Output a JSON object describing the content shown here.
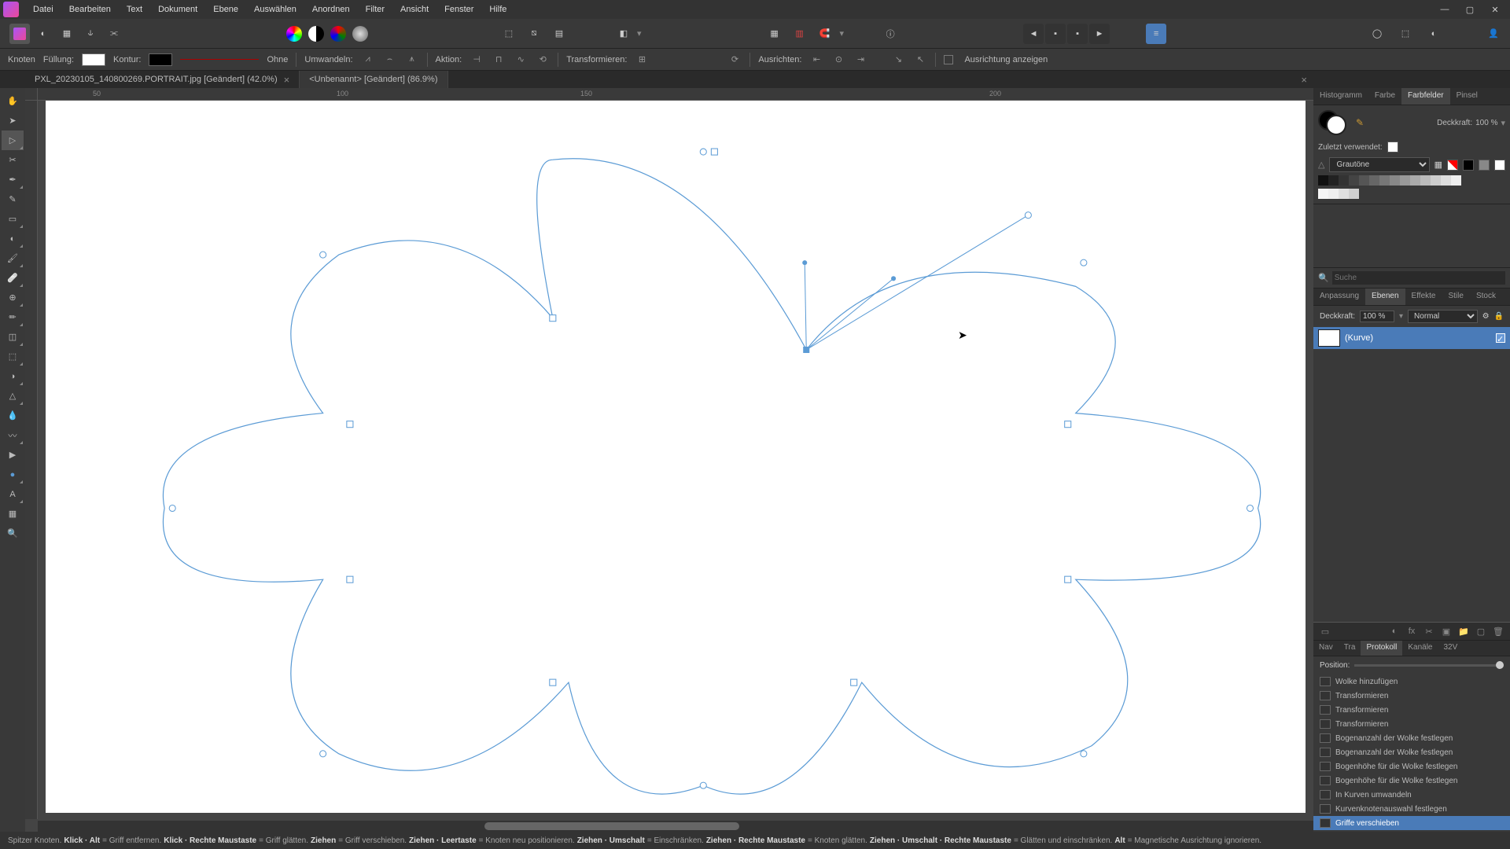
{
  "menu": {
    "items": [
      "Datei",
      "Bearbeiten",
      "Text",
      "Dokument",
      "Ebene",
      "Auswählen",
      "Anordnen",
      "Filter",
      "Ansicht",
      "Fenster",
      "Hilfe"
    ]
  },
  "ctx": {
    "knoten": "Knoten",
    "fuellung": "Füllung:",
    "kontur": "Kontur:",
    "ohne": "Ohne",
    "umwandeln": "Umwandeln:",
    "aktion": "Aktion:",
    "transformieren": "Transformieren:",
    "ausrichten": "Ausrichten:",
    "ausrichtung": "Ausrichtung anzeigen"
  },
  "tabs": {
    "t1": "PXL_20230105_140800269.PORTRAIT.jpg [Geändert] (42.0%)",
    "t2": "<Unbenannt> [Geändert] (86.9%)"
  },
  "ruler": {
    "marks": [
      "50",
      "100",
      "150",
      "200"
    ]
  },
  "right": {
    "topTabs": [
      "Histogramm",
      "Farbe",
      "Farbfelder",
      "Pinsel"
    ],
    "deckkraft_label": "Deckkraft:",
    "deckkraft_value": "100 %",
    "zuletzt": "Zuletzt verwendet:",
    "palette": "Grautöne",
    "suche": "Suche",
    "midTabs": [
      "Anpassung",
      "Ebenen",
      "Effekte",
      "Stile",
      "Stock"
    ],
    "layer_deckkraft": "Deckkraft:",
    "layer_opacity": "100 %",
    "blend": "Normal",
    "layer_name": "(Kurve)",
    "navTabs": [
      "Nav",
      "Tra",
      "Protokoll",
      "Kanäle",
      "32V"
    ],
    "position": "Position:"
  },
  "history": [
    "Wolke hinzufügen",
    "Transformieren",
    "Transformieren",
    "Transformieren",
    "Bogenanzahl der Wolke festlegen",
    "Bogenanzahl der Wolke festlegen",
    "Bogenhöhe für die Wolke festlegen",
    "Bogenhöhe für die Wolke festlegen",
    "In Kurven umwandeln",
    "Kurvenknotenauswahl festlegen",
    "Griffe verschieben"
  ],
  "status": {
    "s1": "Spitzer Knoten.",
    "k1": "Klick · Alt",
    "e1": "= Griff entfernen.",
    "k2": "Klick · Rechte Maustaste",
    "e2": "= Griff glätten.",
    "k3": "Ziehen",
    "e3": "= Griff verschieben.",
    "k4": "Ziehen · Leertaste",
    "e4": "= Knoten neu positionieren.",
    "k5": "Ziehen · Umschalt",
    "e5": "= Einschränken.",
    "k6": "Ziehen · Rechte Maustaste",
    "e6": "= Knoten glätten.",
    "k7": "Ziehen · Umschalt · Rechte Maustaste",
    "e7": "= Glätten und einschränken.",
    "k8": "Alt",
    "e8": "= Magnetische Ausrichtung ignorieren."
  }
}
